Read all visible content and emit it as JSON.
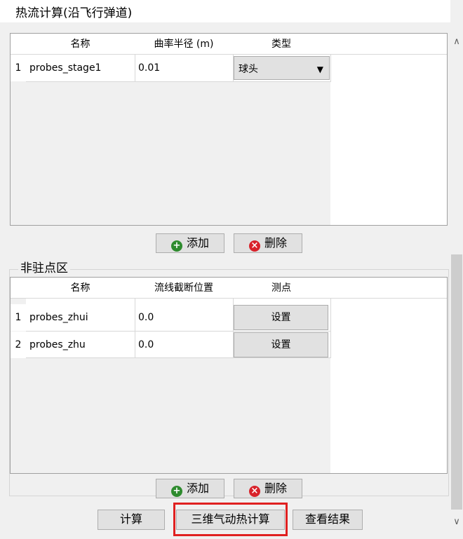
{
  "title": "热流计算(沿飞行弹道)",
  "table1": {
    "headers": [
      "名称",
      "曲率半径 (m)",
      "类型"
    ],
    "rows": [
      {
        "num": "1",
        "name": "probes_stage1",
        "radius": "0.01",
        "type": "球头"
      }
    ]
  },
  "buttons1": {
    "add": "添加",
    "delete": "删除"
  },
  "group2": {
    "label": "非驻点区"
  },
  "table2": {
    "headers": [
      "名称",
      "流线截断位置",
      "测点"
    ],
    "rows": [
      {
        "num": "1",
        "name": "probes_zhui",
        "position": "0.0",
        "action": "设置"
      },
      {
        "num": "2",
        "name": "probes_zhu",
        "position": "0.0",
        "action": "设置"
      }
    ]
  },
  "buttons2": {
    "add": "添加",
    "delete": "删除"
  },
  "footer": {
    "calc": "计算",
    "calc3d": "三维气动热计算",
    "view_results": "查看结果"
  },
  "colors": {
    "highlight": "#e02020",
    "add_icon": "#2e8b2e",
    "delete_icon": "#d8222a"
  },
  "icons": {
    "add": "plus-circle-icon",
    "delete": "x-circle-icon",
    "dropdown": "triangle-down-icon"
  }
}
